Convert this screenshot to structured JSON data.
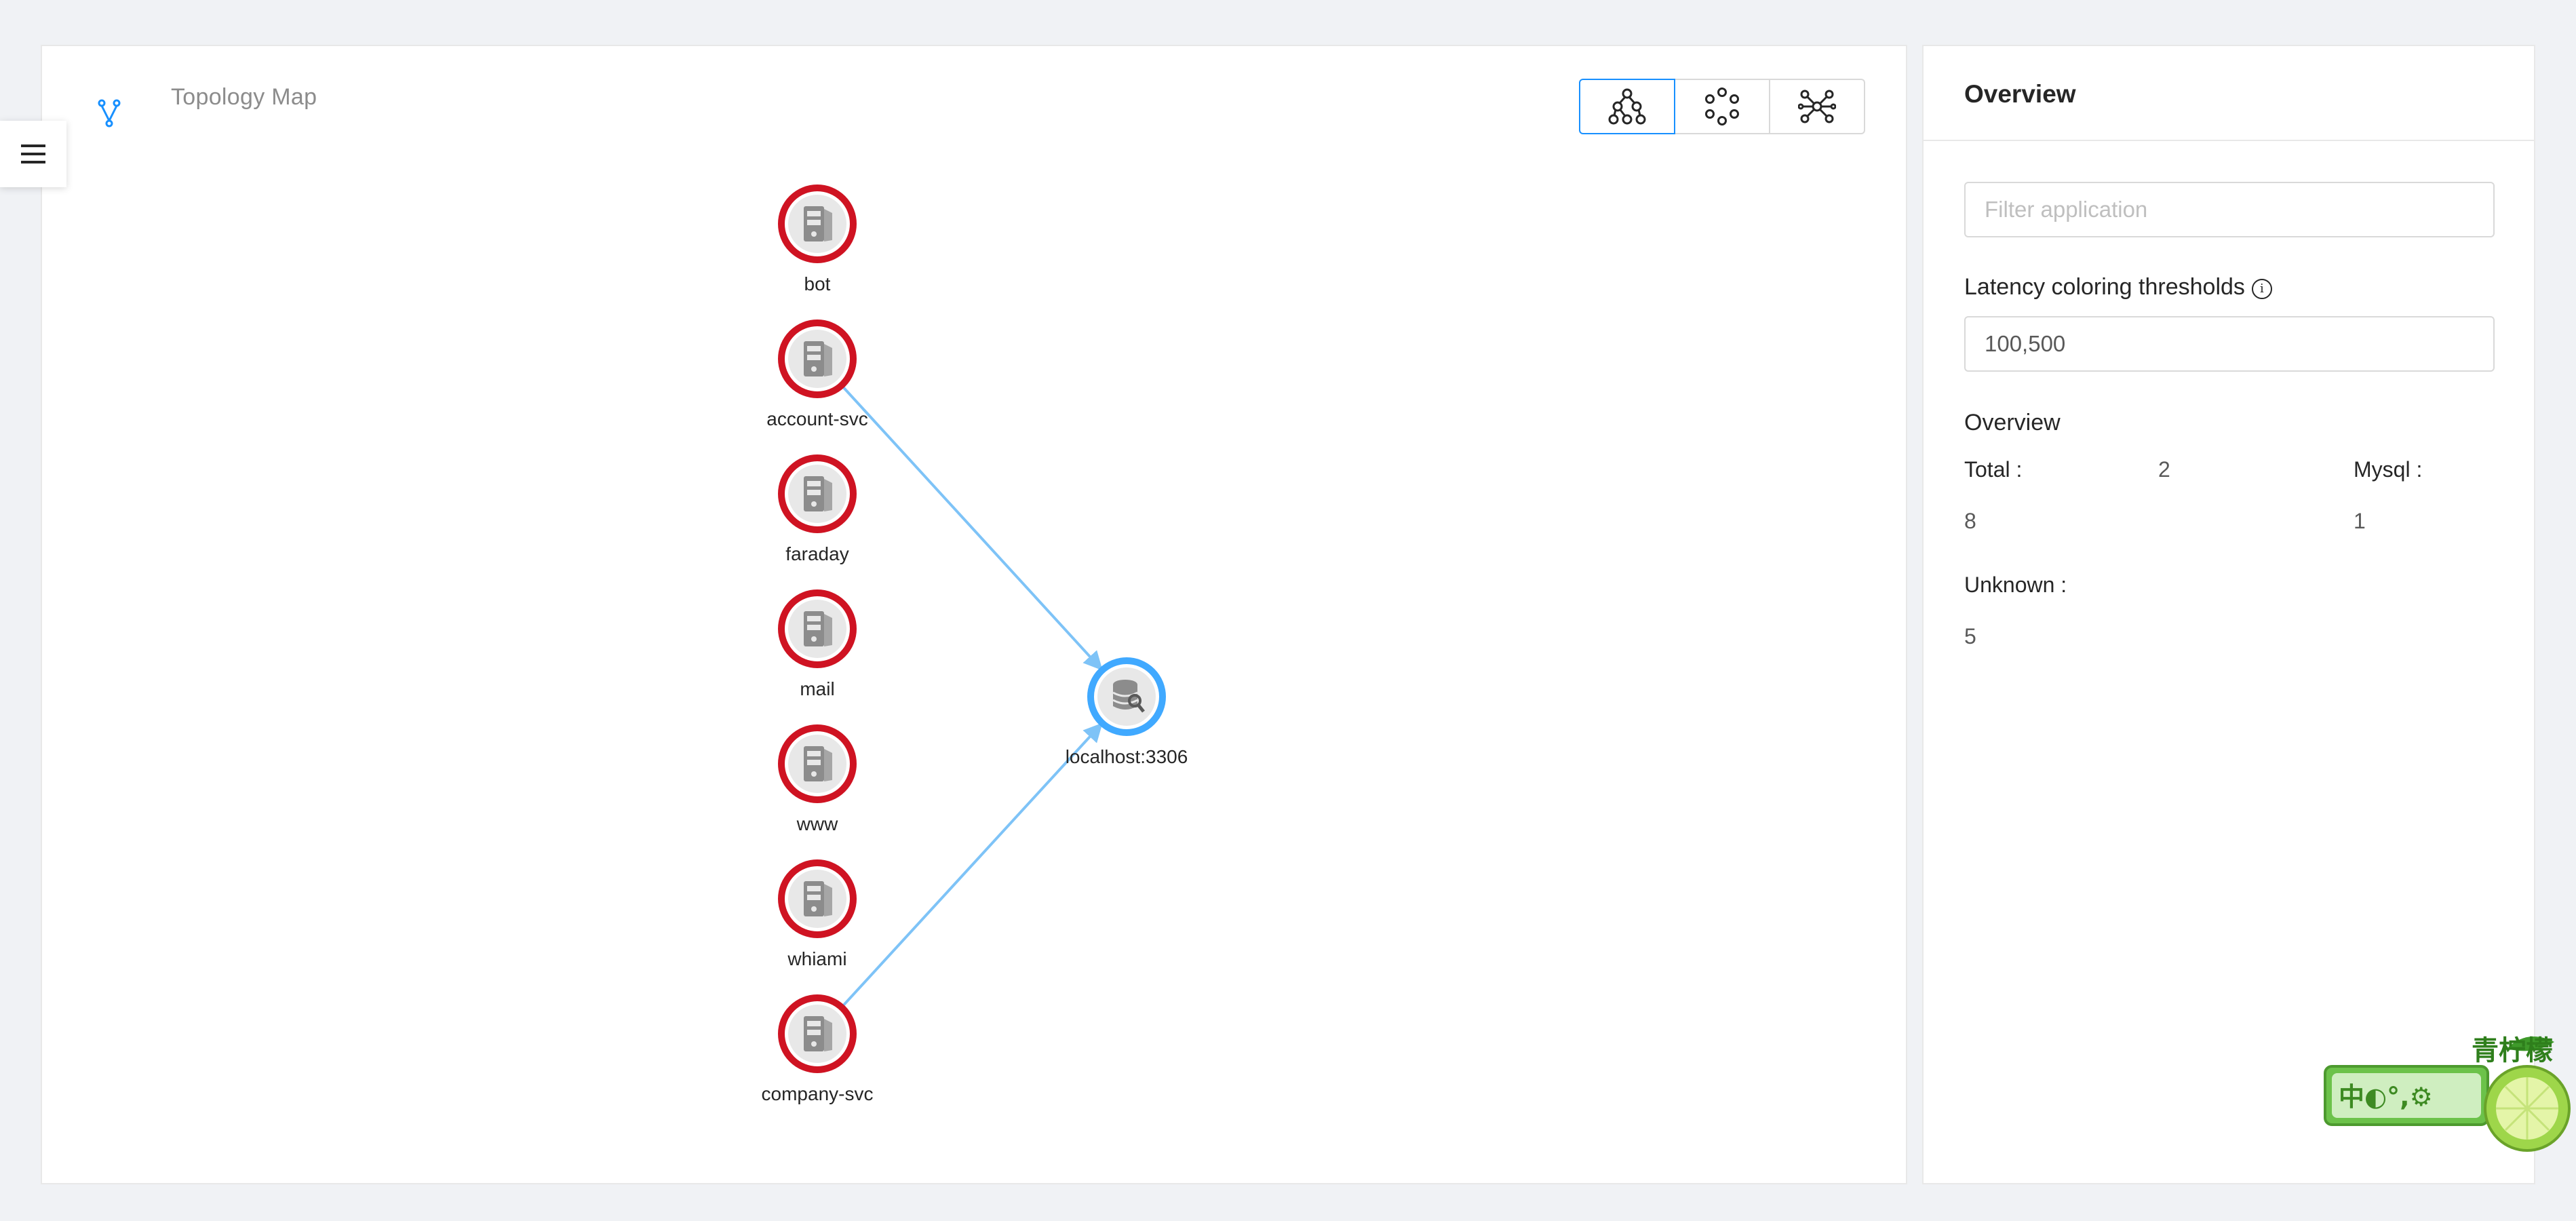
{
  "topology": {
    "title": "Topology Map",
    "layouts": [
      {
        "icon": "tree-layout-icon",
        "active": true
      },
      {
        "icon": "circle-layout-icon",
        "active": false
      },
      {
        "icon": "radial-layout-icon",
        "active": false
      }
    ],
    "nodes": [
      {
        "label": "bot",
        "type": "service",
        "status": "error"
      },
      {
        "label": "account-svc",
        "type": "service",
        "status": "error"
      },
      {
        "label": "faraday",
        "type": "service",
        "status": "error"
      },
      {
        "label": "mail",
        "type": "service",
        "status": "error"
      },
      {
        "label": "www",
        "type": "service",
        "status": "error"
      },
      {
        "label": "whiami",
        "type": "service",
        "status": "error"
      },
      {
        "label": "company-svc",
        "type": "service",
        "status": "error"
      },
      {
        "label": "localhost:3306",
        "type": "database",
        "status": "ok"
      }
    ],
    "edges": [
      {
        "from": "account-svc",
        "to": "localhost:3306"
      },
      {
        "from": "company-svc",
        "to": "localhost:3306"
      }
    ],
    "colors": {
      "error_ring": "#cf1322",
      "ok_ring": "#40a9ff",
      "edge": "#7ec3f7",
      "accent": "#1890ff"
    }
  },
  "overview": {
    "header": "Overview",
    "filter_placeholder": "Filter application",
    "latency_label": "Latency coloring thresholds",
    "latency_value": "100,500",
    "section_title": "Overview",
    "stats": {
      "total_label": "Total :",
      "total_value": "8",
      "mid_value": "2",
      "mysql_label": "Mysql :",
      "mysql_value": "1",
      "unknown_label": "Unknown :",
      "unknown_value": "5"
    }
  },
  "ime_badge": {
    "text": "中◐°,⚙",
    "brand": "青柠檬"
  }
}
